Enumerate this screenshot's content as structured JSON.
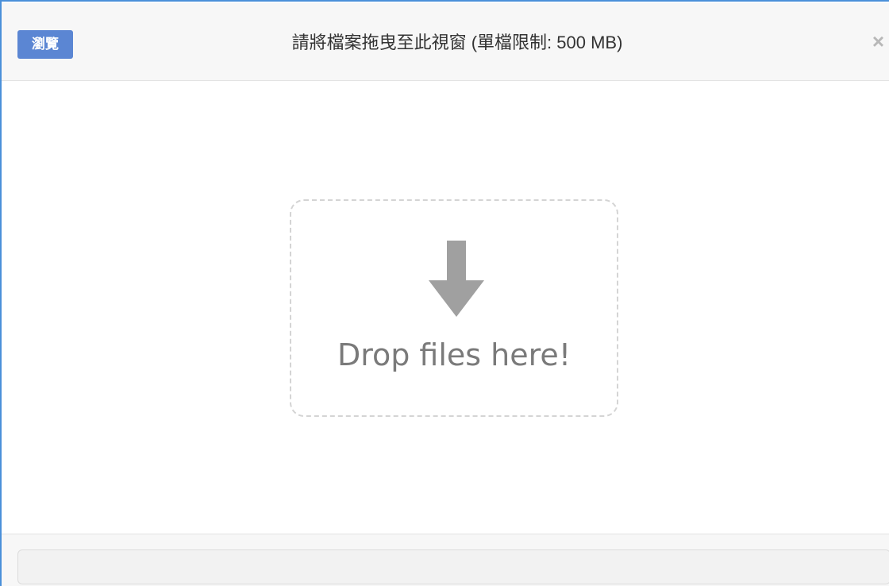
{
  "header": {
    "browse_label": "瀏覽",
    "title": "請將檔案拖曳至此視窗 (單檔限制: 500 MB)",
    "close_glyph": "×"
  },
  "drop_zone": {
    "text": "Drop files here!",
    "icon": "down-arrow-icon"
  },
  "footer": {
    "progress_fraction": 0
  },
  "colors": {
    "accent": "#5b86d3",
    "border_accent": "#4a90d9",
    "header_bg": "#f7f7f7",
    "drop_text": "#7a7a7a",
    "arrow": "#a0a0a0"
  }
}
